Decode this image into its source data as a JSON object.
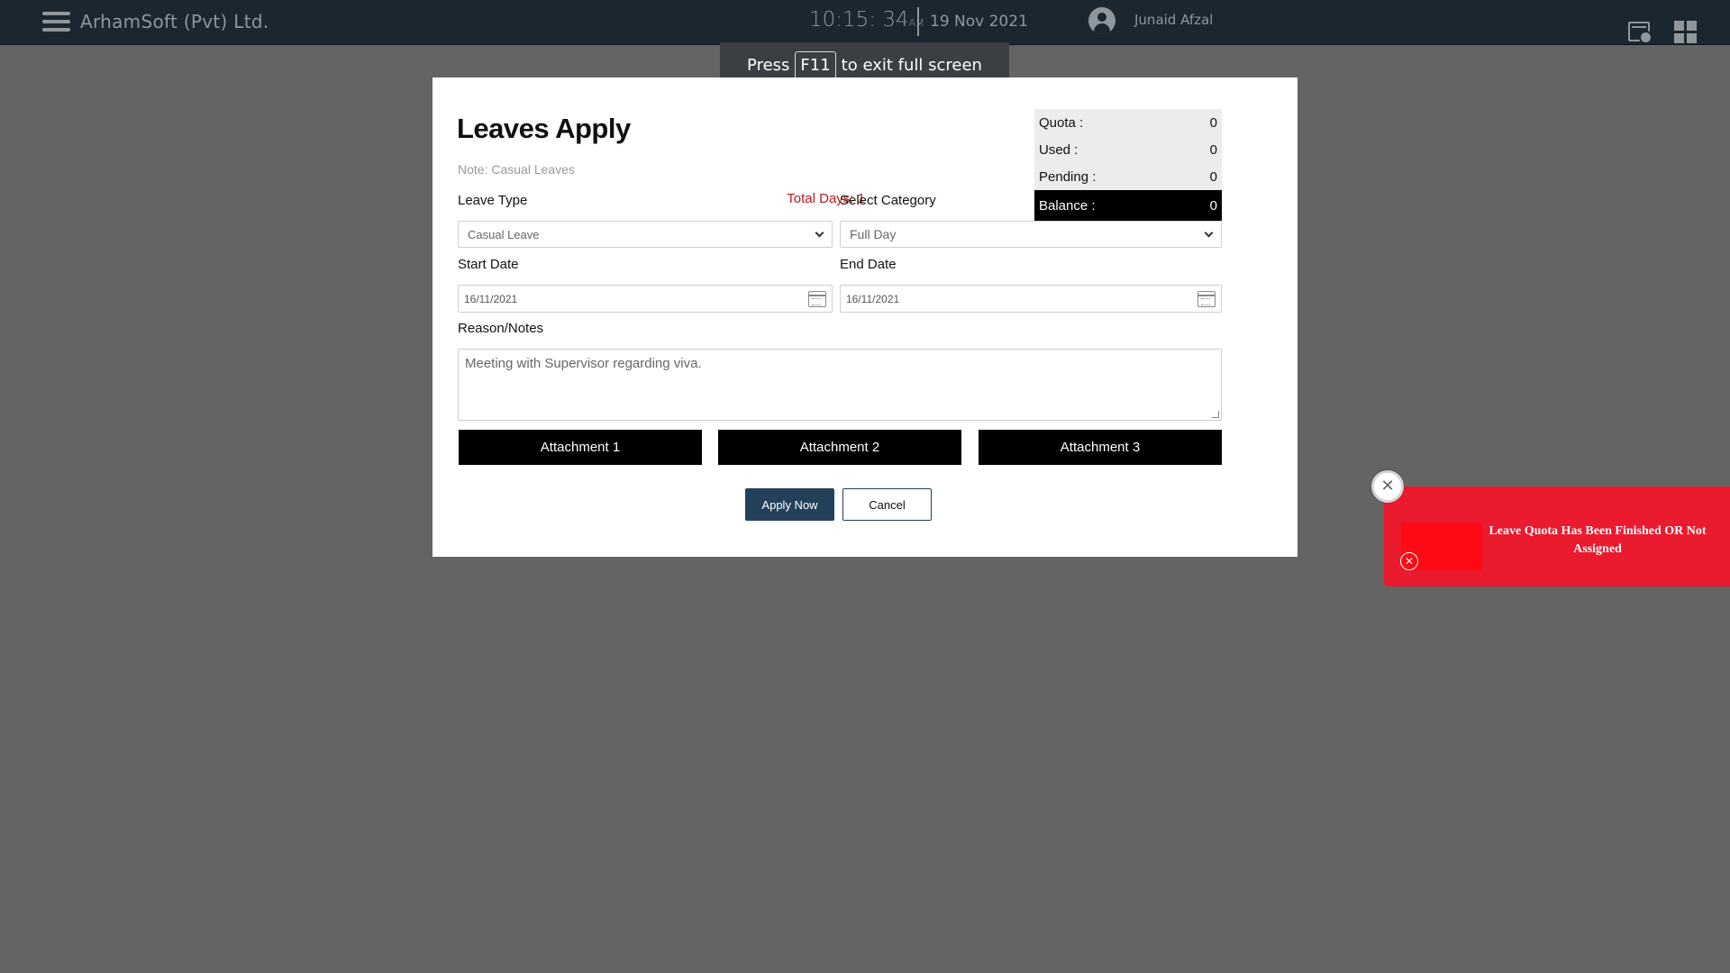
{
  "header": {
    "app_title": "ArhamSoft (Pvt) Ltd.",
    "time": "10:15: 34",
    "ampm": "AM",
    "date": "19 Nov 2021",
    "user_name": "Junaid Afzal",
    "icons": [
      "menu-icon",
      "avatar-icon",
      "calendar-check-icon",
      "grid-icon"
    ]
  },
  "fullscreen_banner": {
    "prefix": "Press",
    "key": "F11",
    "suffix": "to exit full screen"
  },
  "modal": {
    "title": "Leaves Apply",
    "note": "Note: Casual Leaves",
    "leave_type_label": "Leave Type",
    "total_days": "Total Days: 1",
    "category_label": "Select Category",
    "leave_type_value": "Casual Leave",
    "category_value": "Full Day",
    "start_date_label": "Start Date",
    "end_date_label": "End Date",
    "start_date_value": "16/11/2021",
    "end_date_value": "16/11/2021",
    "reason_label": "Reason/Notes",
    "reason_value": "Meeting with Supervisor regarding viva.",
    "attachments": [
      "Attachment 1",
      "Attachment 2",
      "Attachment 3"
    ],
    "apply_label": "Apply Now",
    "cancel_label": "Cancel",
    "quota": {
      "quota_label": "Quota :",
      "quota_value": "0",
      "used_label": "Used :",
      "used_value": "0",
      "pending_label": "Pending :",
      "pending_value": "0",
      "balance_label": "Balance :",
      "balance_value": "0"
    }
  },
  "toast": {
    "message": "Leave Quota Has Been Finished OR Not Assigned",
    "close_symbol": "✕",
    "dismiss_symbol": "✕",
    "color": "#ea1a2f"
  },
  "colors": {
    "topbar": "#1a2731",
    "overlay": "#646464",
    "primary_button": "#24415c",
    "total_days": "#c0181d"
  }
}
